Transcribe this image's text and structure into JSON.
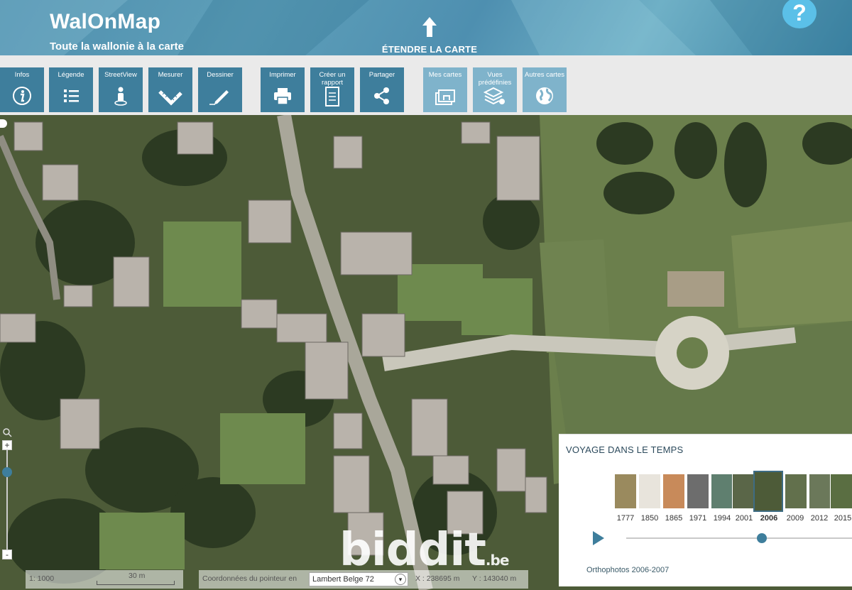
{
  "app": {
    "title": "WalOnMap",
    "subtitle": "Toute la wallonie à la carte",
    "extend_label": "ÉTENDRE LA CARTE",
    "help_label": "?"
  },
  "toolbar": {
    "buttons": [
      {
        "label": "Infos",
        "icon": "info-icon"
      },
      {
        "label": "Légende",
        "icon": "list-icon"
      },
      {
        "label": "StreetView",
        "icon": "person-icon"
      },
      {
        "label": "Mesurer",
        "icon": "ruler-icon"
      },
      {
        "label": "Dessiner",
        "icon": "pencil-icon"
      },
      {
        "label": "Imprimer",
        "icon": "printer-icon"
      },
      {
        "label": "Créer un rapport",
        "icon": "report-icon"
      },
      {
        "label": "Partager",
        "icon": "share-icon"
      },
      {
        "label": "Mes cartes",
        "icon": "maps-stack-icon"
      },
      {
        "label": "Vues prédéfinies",
        "icon": "layers-icon"
      },
      {
        "label": "Autres cartes",
        "icon": "globe-icon"
      }
    ]
  },
  "map": {
    "scale_text": "1: 1000",
    "scale_bar_label": "30 m",
    "pointer_label": "Coordonnées du pointeur en",
    "projection": "Lambert Belge 72",
    "coord_x": "X : 238695 m",
    "coord_y": "Y : 143040 m",
    "zoom_in": "+",
    "zoom_out": "-"
  },
  "time_travel": {
    "title": "VOYAGE DANS LE TEMPS",
    "years": [
      "1777",
      "1850",
      "1865",
      "1971",
      "1994",
      "2001",
      "2006",
      "2009",
      "2012",
      "2015"
    ],
    "selected_year": "2006",
    "caption": "Orthophotos 2006-2007",
    "slider_position": 0.6
  },
  "watermark": {
    "text": "biddit",
    "suffix": ".be"
  },
  "colors": {
    "header": "#4f8fae",
    "button": "#3e7e9c",
    "button_light": "#7fb3cb",
    "help": "#5bc0e8"
  }
}
